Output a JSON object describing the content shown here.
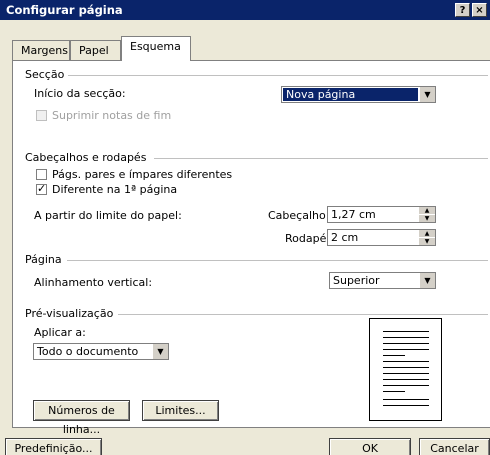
{
  "window": {
    "title": "Configurar página",
    "help_label": "?",
    "close_label": "×"
  },
  "tabs": [
    {
      "label": "Margens",
      "active": false
    },
    {
      "label": "Papel",
      "active": false
    },
    {
      "label": "Esquema",
      "active": true
    }
  ],
  "seccao": {
    "heading": "Secção",
    "inicio_label": "Início da secção:",
    "inicio_value": "Nova página",
    "suprimir_label": "Suprimir notas de fim",
    "suprimir_checked": false
  },
  "cabecalhos": {
    "heading": "Cabeçalhos e rodapés",
    "pares_label": "Págs. pares e ímpares diferentes",
    "pares_checked": false,
    "primeira_label": "Diferente na 1ª página",
    "primeira_checked": true,
    "limite_label": "A partir do limite do papel:",
    "cabecalho_label": "Cabeçalho:",
    "cabecalho_value": "1,27 cm",
    "rodape_label": "Rodapé:",
    "rodape_value": "2 cm"
  },
  "pagina": {
    "heading": "Página",
    "alinhamento_label": "Alinhamento vertical:",
    "alinhamento_value": "Superior"
  },
  "previsualizacao": {
    "heading": "Pré-visualização",
    "aplicar_label": "Aplicar a:",
    "aplicar_value": "Todo o documento"
  },
  "buttons": {
    "numeros_linha": "Números de linha...",
    "limites": "Limites...",
    "predefinicao": "Predefinição...",
    "ok": "OK",
    "cancelar": "Cancelar"
  },
  "colors": {
    "titlebar": "#0a246a",
    "dialog_bg": "#ece9d8",
    "selection": "#0a246a"
  }
}
